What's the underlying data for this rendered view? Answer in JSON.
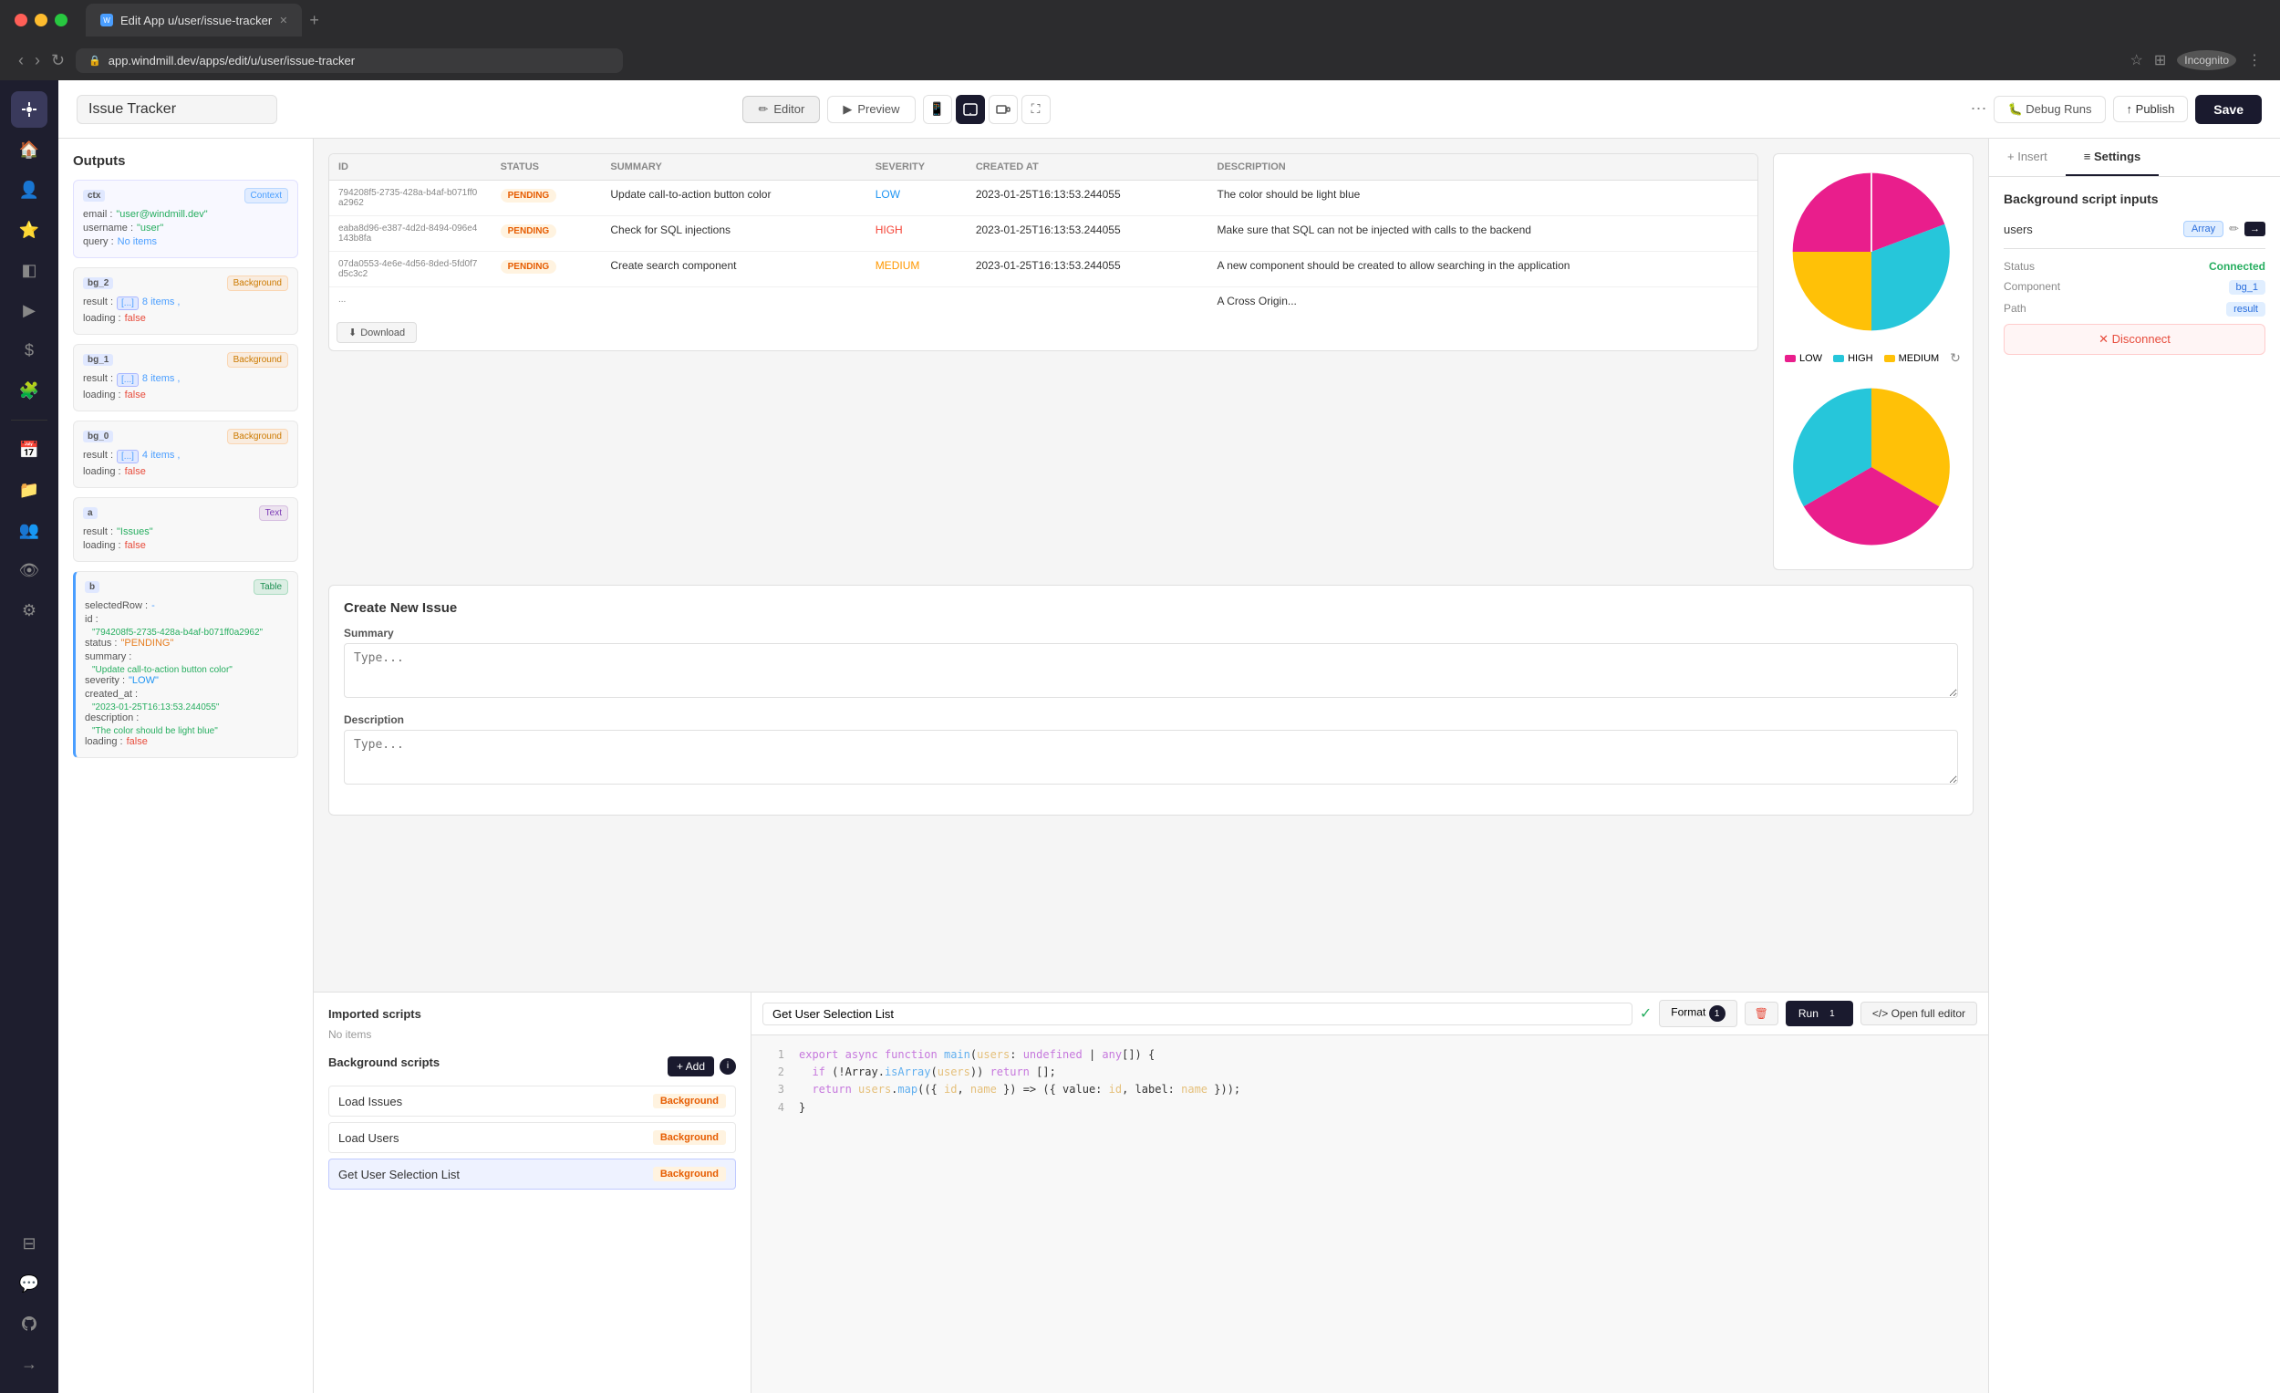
{
  "browser": {
    "tab_title": "Edit App u/user/issue-tracker",
    "url": "app.windmill.dev/apps/edit/u/user/issue-tracker",
    "new_tab_icon": "+"
  },
  "toolbar": {
    "app_title": "Issue Tracker",
    "editor_label": "Editor",
    "preview_label": "Preview",
    "debug_runs_label": "Debug Runs",
    "publish_label": "Publish",
    "save_label": "Save",
    "more_icon": "⋯"
  },
  "left_panel": {
    "title": "Outputs",
    "ctx_block": {
      "label": "ctx",
      "tag": "Context",
      "rows": [
        {
          "key": "email",
          "value": "\"user@windmill.dev\""
        },
        {
          "key": "username",
          "value": "\"user\""
        },
        {
          "key": "query",
          "value": "No items"
        }
      ]
    },
    "bg2_block": {
      "label": "bg_2",
      "tag": "Background",
      "rows": [
        {
          "key": "result",
          "value": "[...] 8 items,"
        },
        {
          "key": "loading",
          "value": "false"
        }
      ]
    },
    "bg1_block": {
      "label": "bg_1",
      "tag": "Background",
      "rows": [
        {
          "key": "result",
          "value": "[...] 8 items,"
        },
        {
          "key": "loading",
          "value": "false"
        }
      ]
    },
    "bg0_block": {
      "label": "bg_0",
      "tag": "Background",
      "rows": [
        {
          "key": "result",
          "value": "[...] 4 items,"
        },
        {
          "key": "loading",
          "value": "false"
        }
      ]
    },
    "a_block": {
      "label": "a",
      "tag": "Text",
      "rows": [
        {
          "key": "result",
          "value": "\"Issues\""
        },
        {
          "key": "loading",
          "value": "false"
        }
      ]
    },
    "b_block": {
      "label": "b",
      "tag": "Table",
      "rows": [
        {
          "key": "selectedRow",
          "value": "-"
        },
        {
          "key": "id",
          "value": ""
        },
        {
          "key": "id_val",
          "value": "\"794208f5-2735-428a-b4af-b071ff0a2962\""
        },
        {
          "key": "status",
          "value": "\"PENDING\""
        },
        {
          "key": "summary",
          "value": ":"
        },
        {
          "key": "summary_val",
          "value": "\"Update call-to-action button color\""
        },
        {
          "key": "severity",
          "value": "\"LOW\""
        },
        {
          "key": "created_at",
          "value": "\"2023-01-25T16:13:53.244055\""
        },
        {
          "key": "description",
          "value": ":"
        },
        {
          "key": "desc_val",
          "value": "\"The color should be light blue\""
        },
        {
          "key": "loading",
          "value": "false"
        }
      ]
    }
  },
  "issues_table": {
    "columns": [
      "ID",
      "STATUS",
      "SUMMARY",
      "SEVERITY",
      "CREATED AT",
      "DESCRIPTION"
    ],
    "rows": [
      {
        "id": "794208f5-2735-428a-b4af-b071ff0a2962",
        "status": "PENDING",
        "summary": "Update call-to-action button color",
        "severity": "LOW",
        "created_at": "2023-01-25T16:13:53.244055",
        "description": "The color should be light blue"
      },
      {
        "id": "eaba8d96-e387-4d2d-8494-096e4143b8fa",
        "status": "PENDING",
        "summary": "Check for SQL injections",
        "severity": "HIGH",
        "created_at": "2023-01-25T16:13:53.244055",
        "description": "Make sure that SQL can not be injected with calls to the backend"
      },
      {
        "id": "07da0553-4e6e-4d56-8ded-5fd0f7d5c3c2",
        "status": "PENDING",
        "summary": "Create search component",
        "severity": "MEDIUM",
        "created_at": "2023-01-25T16:13:53.244055",
        "description": "A new component should be created to allow searching in the application"
      },
      {
        "id": "...",
        "status": "",
        "summary": "",
        "severity": "",
        "created_at": "",
        "description": "A Cross Origin..."
      }
    ],
    "download_label": "Download"
  },
  "pie_chart": {
    "legend_items": [
      {
        "label": "LOW",
        "color": "#e91e8c"
      },
      {
        "label": "HIGH",
        "color": "#26c6da"
      },
      {
        "label": "MEDIUM",
        "color": "#ffc107"
      }
    ],
    "segments": [
      {
        "label": "LOW",
        "value": 35,
        "color": "#e91e8c"
      },
      {
        "label": "MEDIUM",
        "value": 30,
        "color": "#ffc107"
      },
      {
        "label": "HIGH",
        "value": 35,
        "color": "#26c6da"
      }
    ]
  },
  "create_issue": {
    "title": "Create New Issue",
    "summary_label": "Summary",
    "summary_placeholder": "Type...",
    "description_label": "Description",
    "description_placeholder": "Type..."
  },
  "bottom_scripts": {
    "imported_title": "Imported scripts",
    "imported_empty": "No items",
    "background_title": "Background scripts",
    "add_label": "+ Add",
    "info_icon": "i",
    "scripts": [
      {
        "name": "Load Issues",
        "tag": "Background"
      },
      {
        "name": "Load Users",
        "tag": "Background"
      },
      {
        "name": "Get User Selection List",
        "tag": "Background"
      }
    ]
  },
  "code_editor": {
    "script_name": "Get User Selection List",
    "format_label": "Format",
    "run_label": "Run",
    "open_editor_label": "Open full editor",
    "lines": [
      {
        "num": "1",
        "content": "export async function main(users: undefined | any[]) {"
      },
      {
        "num": "2",
        "content": "  if (!Array.isArray(users)) return [];"
      },
      {
        "num": "3",
        "content": "  return users.map(({ id, name }) => ({ value: id, label: name }));"
      },
      {
        "num": "4",
        "content": "}"
      }
    ]
  },
  "right_panel": {
    "tabs": [
      "Insert",
      "Settings"
    ],
    "active_tab": "Settings",
    "heading": "Background script inputs",
    "inputs": [
      {
        "label": "users",
        "type_badge": "Array",
        "has_edit": true,
        "has_arrow": true
      }
    ],
    "status_label": "Status",
    "status_value": "Connected",
    "component_label": "Component",
    "component_value": "bg_1",
    "path_label": "Path",
    "path_value": "result",
    "disconnect_label": "✕ Disconnect"
  }
}
